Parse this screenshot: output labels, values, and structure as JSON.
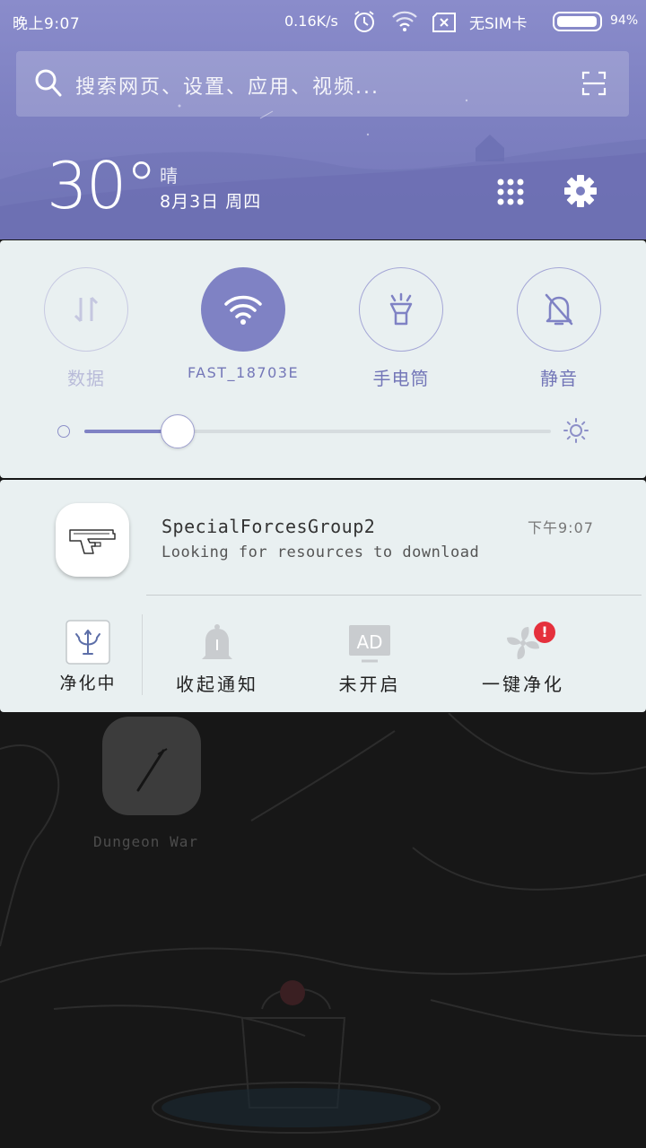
{
  "status_bar": {
    "time": "晚上9:07",
    "net_speed": "0.16K/s",
    "sim": "无SIM卡",
    "battery_percent": "94%",
    "battery_level": 0.94,
    "icons": [
      "alarm-icon",
      "wifi-icon",
      "no-sim-icon",
      "battery-icon"
    ]
  },
  "search": {
    "placeholder": "搜索网页、设置、应用、视频..."
  },
  "weather": {
    "temperature": "30°",
    "condition": "晴",
    "date": "8月3日  周四"
  },
  "quick_settings": {
    "toggles": [
      {
        "label": "数据",
        "icon": "mobile-data-icon",
        "state": "off"
      },
      {
        "label": "FAST_18703E",
        "icon": "wifi-icon",
        "state": "on"
      },
      {
        "label": "手电筒",
        "icon": "flashlight-icon",
        "state": "enabled"
      },
      {
        "label": "静音",
        "icon": "mute-bell-icon",
        "state": "enabled"
      }
    ],
    "brightness": 0.2
  },
  "notification": {
    "app_icon": "pistol-icon",
    "title": "SpecialForcesGroup2",
    "time": "下午9:07",
    "body": "Looking for resources to download",
    "actions": [
      {
        "label": "净化中",
        "icon": "trident-icon"
      },
      {
        "label": "收起通知",
        "icon": "bell-icon"
      },
      {
        "label": "未开启",
        "icon": "ad-icon"
      },
      {
        "label": "一键净化",
        "icon": "fan-icon",
        "badge": "!"
      }
    ]
  },
  "home": {
    "app_label": "Dungeon War",
    "app_icon": "sword-icon"
  },
  "colors": {
    "accent": "#7f82c4",
    "header_bg": "#8a8ccb",
    "panel_bg": "#e9f0f1",
    "badge_red": "#e5303c"
  }
}
